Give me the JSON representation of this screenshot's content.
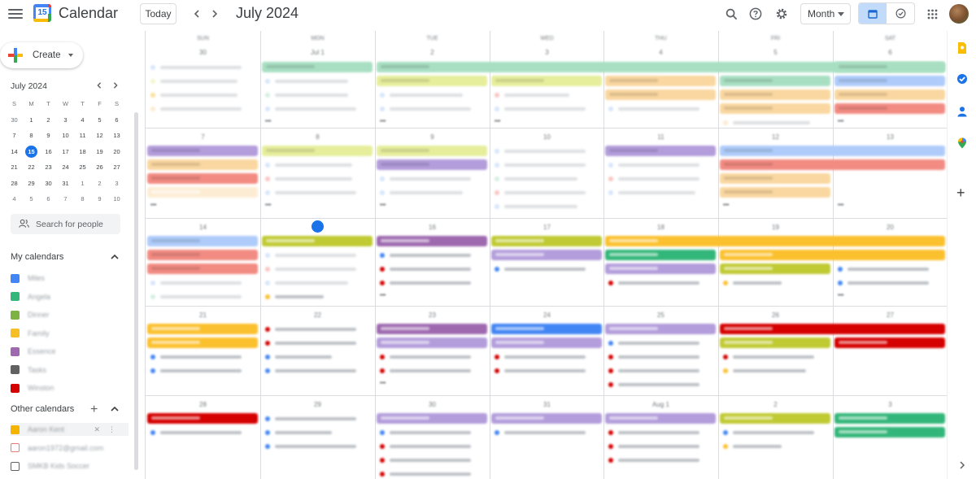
{
  "header": {
    "app_title": "Calendar",
    "logo_day": "15",
    "today_label": "Today",
    "period": "July 2024",
    "view_select": "Month"
  },
  "sidebar": {
    "create_label": "Create",
    "mini_cal": {
      "title": "July 2024",
      "weekday_headers": [
        "S",
        "M",
        "T",
        "W",
        "T",
        "F",
        "S"
      ],
      "weeks": [
        [
          "30",
          "1",
          "2",
          "3",
          "4",
          "5",
          "6"
        ],
        [
          "7",
          "8",
          "9",
          "10",
          "11",
          "12",
          "13"
        ],
        [
          "14",
          "15",
          "16",
          "17",
          "18",
          "19",
          "20"
        ],
        [
          "21",
          "22",
          "23",
          "24",
          "25",
          "26",
          "27"
        ],
        [
          "28",
          "29",
          "30",
          "31",
          "1",
          "2",
          "3"
        ],
        [
          "4",
          "5",
          "6",
          "7",
          "8",
          "9",
          "10"
        ]
      ],
      "today": "15"
    },
    "search_people_placeholder": "Search for people",
    "my_calendars_title": "My calendars",
    "my_calendars": [
      {
        "label": "Miles",
        "color": "#4285f4"
      },
      {
        "label": "Angela",
        "color": "#33b679"
      },
      {
        "label": "Dinner",
        "color": "#7cb342"
      },
      {
        "label": "Family",
        "color": "#f6bf26"
      },
      {
        "label": "Essence",
        "color": "#9e69af"
      },
      {
        "label": "Tasks",
        "color": "#616161"
      },
      {
        "label": "Winston",
        "color": "#d50000"
      }
    ],
    "other_calendars_title": "Other calendars",
    "other_calendars": [
      {
        "label": "Aaron Kent",
        "color": "#f4b400"
      },
      {
        "label": "aaron1972@gmail.com",
        "color": "#e67c73"
      },
      {
        "label": "SMKB Kids Soccer",
        "color": "#616161"
      }
    ]
  },
  "grid": {
    "weekday_headers": [
      "SUN",
      "MON",
      "TUE",
      "WED",
      "THU",
      "FRI",
      "SAT"
    ],
    "weeks": [
      [
        "30",
        "Jul 1",
        "2",
        "3",
        "4",
        "5",
        "6"
      ],
      [
        "7",
        "8",
        "9",
        "10",
        "11",
        "12",
        "13"
      ],
      [
        "14",
        "15",
        "16",
        "17",
        "18",
        "19",
        "20"
      ],
      [
        "21",
        "22",
        "23",
        "24",
        "25",
        "26",
        "27"
      ],
      [
        "28",
        "29",
        "30",
        "31",
        "Aug 1",
        "2",
        "3"
      ]
    ]
  },
  "colors": {
    "accent": "#1a73e8",
    "event_green": "#33b679",
    "event_mint": "#a8dfc2",
    "event_lime": "#c0ca33",
    "event_lime_light": "#e6ee9c",
    "event_lavender": "#b39ddb",
    "event_purple": "#9e69af",
    "event_red": "#d50000",
    "event_pink": "#f28b82",
    "event_yellow": "#fbc02d",
    "event_peach": "#fad7a0",
    "event_blue": "#4285f4",
    "event_sky": "#aecbfa"
  }
}
